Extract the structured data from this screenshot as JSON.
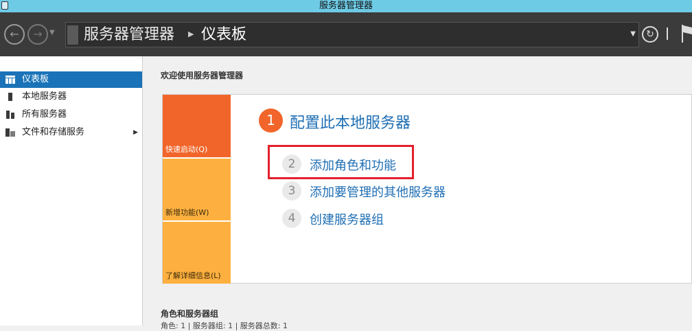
{
  "window": {
    "title": "服务器管理器"
  },
  "nav": {
    "breadcrumb": [
      "服务器管理器",
      "仪表板"
    ]
  },
  "sidebar": {
    "items": [
      {
        "label": "仪表板",
        "icon": "dashboard-icon",
        "active": true
      },
      {
        "label": "本地服务器",
        "icon": "server-icon",
        "active": false
      },
      {
        "label": "所有服务器",
        "icon": "servers-icon",
        "active": false
      },
      {
        "label": "文件和存储服务",
        "icon": "storage-icon",
        "active": false,
        "has_submenu": true
      }
    ]
  },
  "main": {
    "welcome": "欢迎使用服务器管理器",
    "tiles": [
      "快速启动(Q)",
      "新增功能(W)",
      "了解详细信息(L)"
    ],
    "steps": [
      {
        "num": "1",
        "label": "配置此本地服务器"
      },
      {
        "num": "2",
        "label": "添加角色和功能"
      },
      {
        "num": "3",
        "label": "添加要管理的其他服务器"
      },
      {
        "num": "4",
        "label": "创建服务器组"
      }
    ],
    "roles_section": {
      "title": "角色和服务器组",
      "counts": "角色: 1 | 服务器组: 1 | 服务器总数: 1"
    }
  },
  "colors": {
    "accent": "#1a73b8",
    "tile_orange": "#f2652a",
    "tile_yellow": "#fdb03f",
    "link": "#1f6fb4",
    "highlight": "#e3202b"
  }
}
